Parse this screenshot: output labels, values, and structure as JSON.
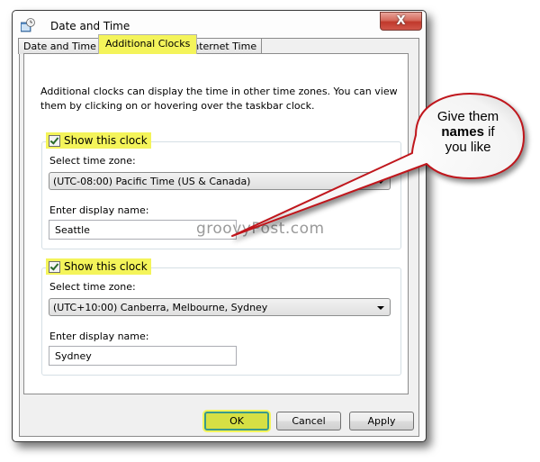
{
  "window": {
    "title": "Date and Time",
    "close_label": "X"
  },
  "tabs": [
    {
      "label": "Date and Time",
      "active": false
    },
    {
      "label": "Additional Clocks",
      "active": true
    },
    {
      "label": "Internet Time",
      "active": false
    }
  ],
  "intro_text": "Additional clocks can display the time in other time zones. You can view them by clicking on or hovering over the taskbar clock.",
  "clocks": [
    {
      "show_label": "Show this clock",
      "checked": true,
      "timezone_label": "Select time zone:",
      "timezone_value": "(UTC-08:00) Pacific Time (US & Canada)",
      "name_label": "Enter display name:",
      "name_value": "Seattle"
    },
    {
      "show_label": "Show this clock",
      "checked": true,
      "timezone_label": "Select time zone:",
      "timezone_value": "(UTC+10:00) Canberra, Melbourne, Sydney",
      "name_label": "Enter display name:",
      "name_value": "Sydney"
    }
  ],
  "buttons": {
    "ok": "OK",
    "cancel": "Cancel",
    "apply": "Apply"
  },
  "callout": {
    "line1": "Give them",
    "bold": "names",
    "line2_rest": " if",
    "line3": "you like"
  },
  "watermark": "groovyPost.com",
  "colors": {
    "highlight": "#f4f45a",
    "callout_border": "#c0161c"
  }
}
